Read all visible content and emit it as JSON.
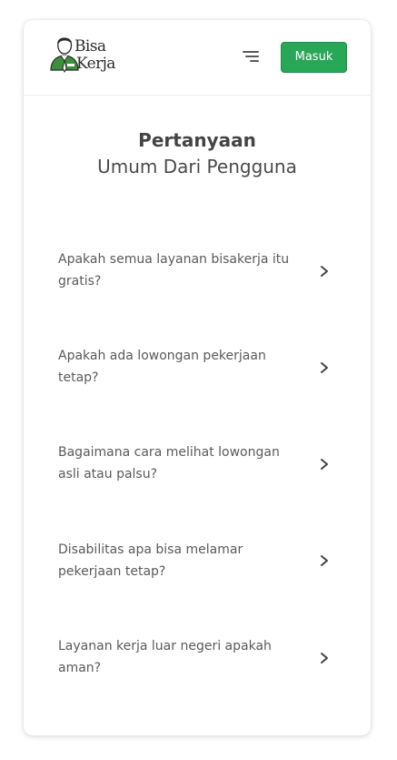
{
  "header": {
    "logo": {
      "line1": "Bisa",
      "line2": "Kerja",
      "icon": "person-with-tie-icon"
    },
    "menu_icon": "menu-lines-icon",
    "login_label": "Masuk"
  },
  "faq": {
    "title_bold": "Pertanyaan",
    "title_light": "Umum Dari Pengguna",
    "items": [
      {
        "question": "Apakah semua layanan bisakerja itu gratis?"
      },
      {
        "question": "Apakah ada lowongan pekerjaan tetap?"
      },
      {
        "question": "Bagaimana cara melihat lowongan asli atau palsu?"
      },
      {
        "question": "Disabilitas apa bisa melamar pekerjaan tetap?"
      },
      {
        "question": "Layanan kerja luar negeri apakah aman?"
      }
    ]
  },
  "colors": {
    "accent": "#28a757",
    "text": "#444444"
  }
}
